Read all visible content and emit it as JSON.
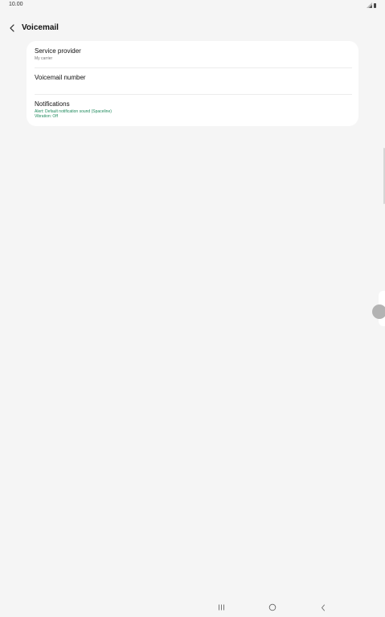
{
  "status_bar": {
    "time": "10.00",
    "icons": [
      "signal-icon",
      "battery-icon"
    ]
  },
  "app_bar": {
    "back_icon": "chevron-left-icon",
    "title": "Voicemail"
  },
  "settings": {
    "items": [
      {
        "title": "Service provider",
        "subtitle": "My carrier"
      },
      {
        "title": "Voicemail number"
      },
      {
        "title": "Notifications",
        "subtitle_lines": [
          "Alert: Default notification sound (Spaceline)",
          "Vibration: Off"
        ]
      }
    ]
  },
  "navigation_bar": {
    "buttons": [
      "recents-icon",
      "home-icon",
      "back-icon"
    ]
  },
  "colors": {
    "background": "#f5f5f5",
    "card": "#ffffff",
    "accent_green": "#1e8a5c"
  }
}
